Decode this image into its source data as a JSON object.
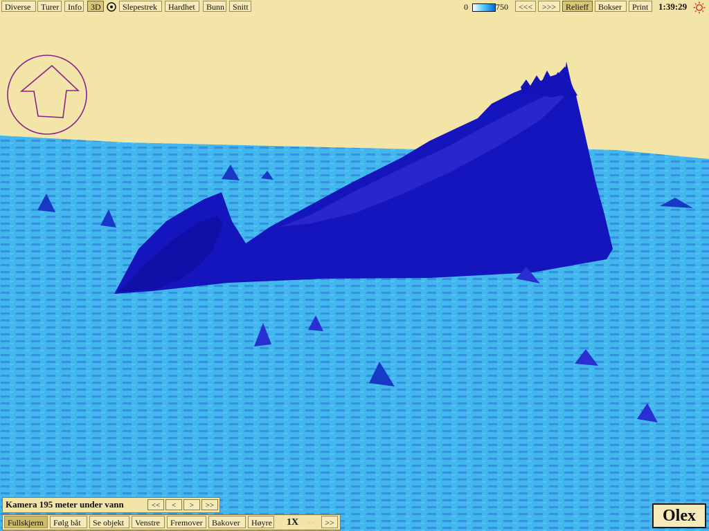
{
  "toolbar": {
    "left": [
      "Diverse",
      "Turer",
      "Info",
      "3D",
      "Slepestrek",
      "Hardhet",
      "Bunn",
      "Snitt"
    ],
    "scale_min": "0",
    "scale_max": "750",
    "nav_back": "<<<",
    "nav_forward": ">>>",
    "mode_active": "Relieff",
    "boxes": "Bokser",
    "print": "Print",
    "clock": "1:39:29"
  },
  "camera": {
    "label": "Kamera 195 meter under vann",
    "controls": [
      "<<",
      "<",
      ">",
      ">>"
    ]
  },
  "bottombar": {
    "buttons": [
      "Fullskjerm",
      "Følg båt",
      "Se objekt",
      "Venstre",
      "Fremover",
      "Bakover",
      "Høyre"
    ],
    "speed": "1X",
    "speed_down": "<<",
    "speed_up": ">>"
  },
  "app": {
    "logo": "Olex"
  },
  "colors": {
    "background": "#f3e5a8",
    "sea_floor": "#3db8f0",
    "deep_blue": "#1414bf",
    "compass": "#8a1f8e"
  }
}
